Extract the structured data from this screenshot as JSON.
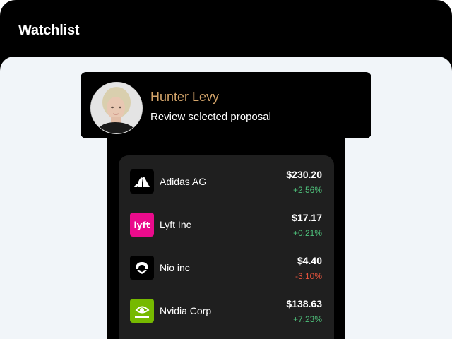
{
  "header": {
    "title": "Watchlist"
  },
  "profile": {
    "name": "Hunter Levy",
    "subtitle": "Review selected proposal",
    "name_color": "#d3a46a"
  },
  "watchlist": [
    {
      "company": "Adidas AG",
      "price": "$230.20",
      "change": "+2.56%",
      "direction": "up",
      "logo": "adidas-logo-icon",
      "logo_bg": "#000000"
    },
    {
      "company": "Lyft Inc",
      "price": "$17.17",
      "change": "+0.21%",
      "direction": "up",
      "logo": "lyft-logo-icon",
      "logo_bg": "#ea0b8c"
    },
    {
      "company": "Nio inc",
      "price": "$4.40",
      "change": "-3.10%",
      "direction": "down",
      "logo": "nio-logo-icon",
      "logo_bg": "#000000"
    },
    {
      "company": "Nvidia Corp",
      "price": "$138.63",
      "change": "+7.23%",
      "direction": "up",
      "logo": "nvidia-logo-icon",
      "logo_bg": "#76b900"
    }
  ],
  "colors": {
    "positive": "#4ebf7a",
    "negative": "#e5533d",
    "background": "#f1f5f9"
  }
}
